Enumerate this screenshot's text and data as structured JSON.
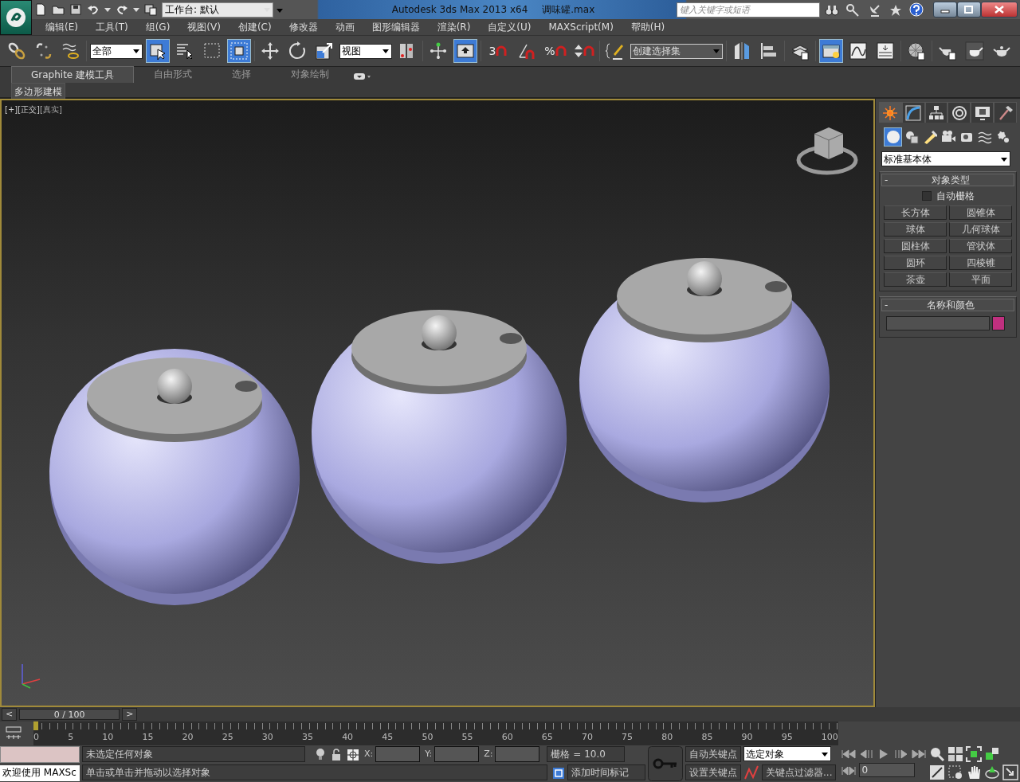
{
  "title_bar": {
    "workspace": "工作台: 默认",
    "app_title": "Autodesk 3ds Max  2013 x64",
    "file_name": "调味罐.max",
    "search": {
      "placeholder": "键入关键字或短语"
    }
  },
  "menu": [
    "编辑(E)",
    "工具(T)",
    "组(G)",
    "视图(V)",
    "创建(C)",
    "修改器",
    "动画",
    "图形编辑器",
    "渲染(R)",
    "自定义(U)",
    "MAXScript(M)",
    "帮助(H)"
  ],
  "main_toolbar": {
    "selection_filter": "全部",
    "reference_coord": "视图",
    "snap_label": "3",
    "percent_label": "%",
    "named_selection": "创建选择集"
  },
  "ribbon": {
    "tabs": [
      {
        "label": "Graphite 建模工具",
        "selected": true
      },
      {
        "label": "自由形式",
        "selected": false
      },
      {
        "label": "选择",
        "selected": false
      },
      {
        "label": "对象绘制",
        "selected": false
      }
    ],
    "panel": "多边形建模"
  },
  "viewport": {
    "labels": [
      "[+]",
      "[正交]",
      "[真实]"
    ]
  },
  "command_panel": {
    "tabs": [
      {
        "selected": true
      },
      {
        "selected": false
      },
      {
        "selected": false
      },
      {
        "selected": false
      },
      {
        "selected": false
      },
      {
        "selected": false
      }
    ],
    "categories": [
      {
        "selected": true
      },
      {
        "selected": false
      },
      {
        "selected": false
      },
      {
        "selected": false
      },
      {
        "selected": false
      },
      {
        "selected": false
      },
      {
        "selected": false
      }
    ],
    "dropdown": "标准基本体",
    "object_type": {
      "collapse": "-",
      "title": "对象类型",
      "auto_grid": {
        "label": "自动栅格",
        "checked": false
      },
      "buttons": [
        "长方体",
        "圆锥体",
        "球体",
        "几何球体",
        "圆柱体",
        "管状体",
        "圆环",
        "四棱锥",
        "茶壶",
        "平面"
      ]
    },
    "name_color": {
      "collapse": "-",
      "title": "名称和颜色"
    }
  },
  "time_slider": {
    "prev": "<",
    "label": "0 / 100",
    "next": ">",
    "level": 0
  },
  "track_bar": {
    "ticks": [
      "0",
      "5",
      "10",
      "15",
      "20",
      "25",
      "30",
      "35",
      "40",
      "45",
      "50",
      "55",
      "60",
      "65",
      "70",
      "75",
      "80",
      "85",
      "90",
      "95",
      "100"
    ]
  },
  "status": {
    "welcome": "欢迎使用 MAXSc",
    "selection": "未选定任何对象",
    "prompt": "单击或单击并拖动以选择对象",
    "x_label": "X:",
    "y_label": "Y:",
    "z_label": "Z:",
    "grid": "栅格 = 10.0",
    "time_tag": "添加时间标记",
    "auto_key": "自动关键点",
    "set_key": "设置关键点",
    "key_mode": "选定对象",
    "key_filters": "关键点过滤器...",
    "frame": "0"
  }
}
